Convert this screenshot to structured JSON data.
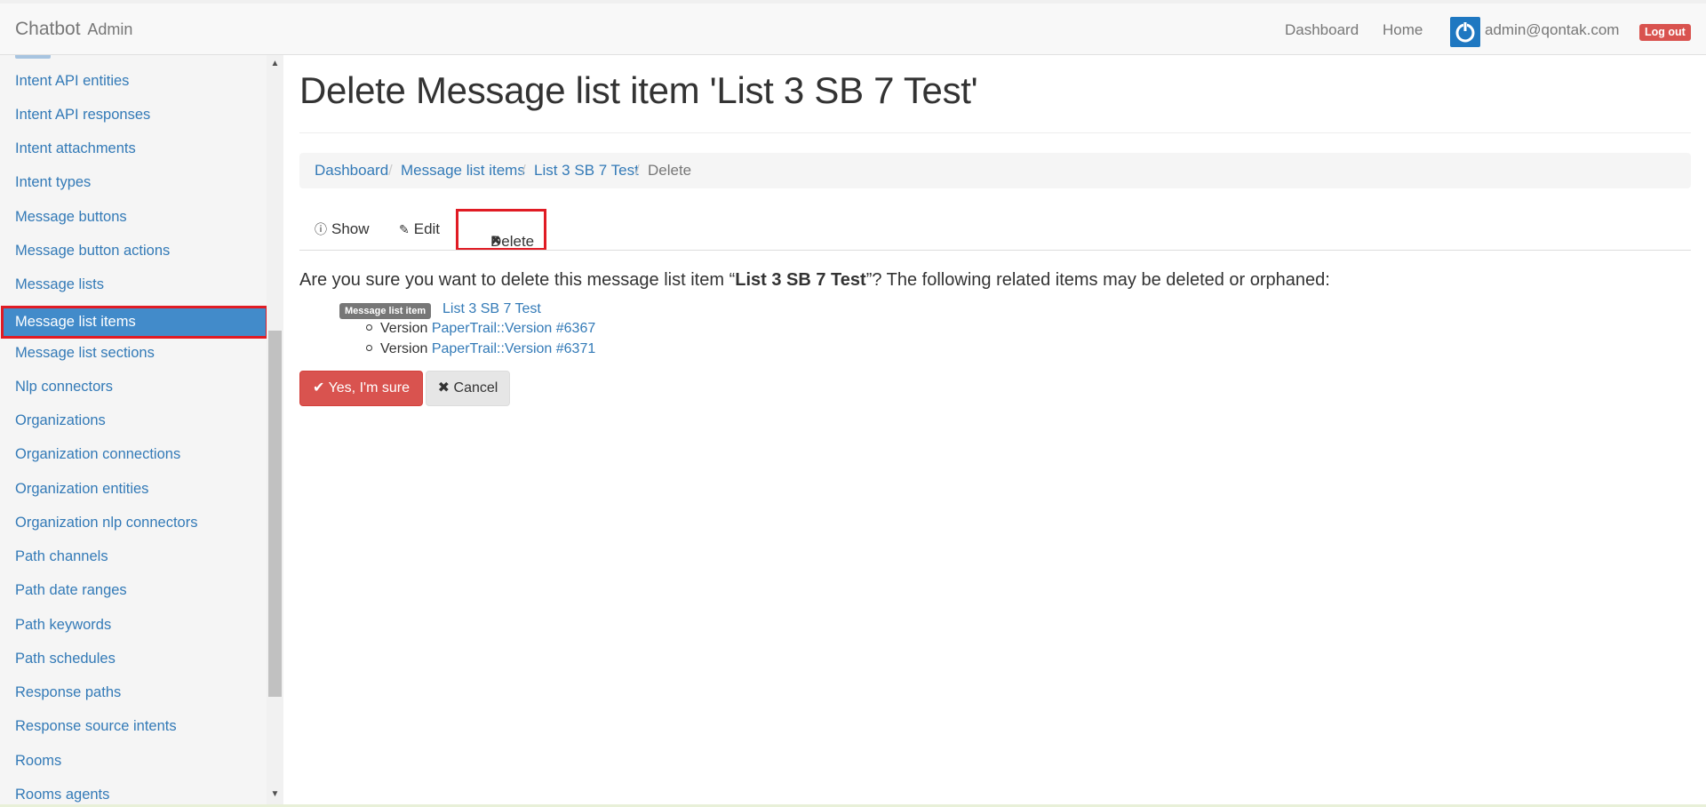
{
  "navbar": {
    "brand": "Chatbot",
    "brand_sub": "Admin",
    "links": [
      "Dashboard",
      "Home"
    ],
    "user_email": "admin@qontak.com",
    "logout_label": "Log out"
  },
  "sidebar": {
    "items": [
      "Intent API entities",
      "Intent API responses",
      "Intent attachments",
      "Intent types",
      "Message buttons",
      "Message button actions",
      "Message lists",
      "Message list items",
      "Message list sections",
      "Nlp connectors",
      "Organizations",
      "Organization connections",
      "Organization entities",
      "Organization nlp connectors",
      "Path channels",
      "Path date ranges",
      "Path keywords",
      "Path schedules",
      "Response paths",
      "Response source intents",
      "Rooms",
      "Rooms agents"
    ],
    "active_item": "Message list items"
  },
  "page": {
    "title": "Delete Message list item 'List 3 SB 7 Test'",
    "breadcrumb": [
      "Dashboard",
      "Message list items",
      "List 3 SB 7 Test",
      "Delete"
    ],
    "tabs": [
      {
        "icon": "info-circle-icon",
        "label": "Show"
      },
      {
        "icon": "pencil-icon",
        "label": "Edit"
      },
      {
        "icon": "times-icon",
        "label": "Delete"
      }
    ],
    "question_prefix": "Are you sure you want to delete this message list item “",
    "question_name": "List 3 SB 7 Test",
    "question_suffix": "”? The following related items may be deleted or orphaned:",
    "related": {
      "badge": "Message list item",
      "link": "List 3 SB 7 Test",
      "versions": [
        {
          "prefix": "Version",
          "link": "PaperTrail::Version #6367"
        },
        {
          "prefix": "Version",
          "link": "PaperTrail::Version #6371"
        }
      ]
    },
    "confirm_label": "Yes, I'm sure",
    "cancel_label": "Cancel"
  },
  "colors": {
    "link": "#337ab7",
    "danger": "#d9534f",
    "active_bg": "#428bca",
    "highlight_border": "#e01b24"
  }
}
